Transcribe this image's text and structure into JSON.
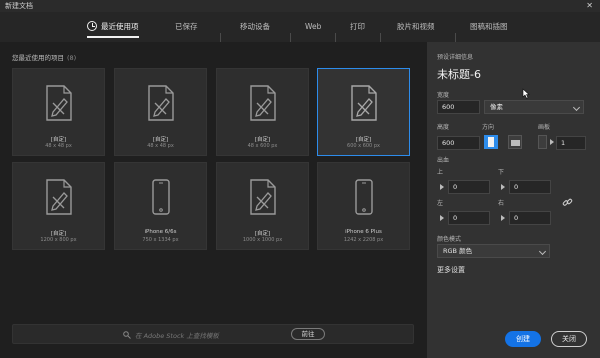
{
  "window": {
    "title": "新建文档",
    "close": "✕"
  },
  "tabs": [
    {
      "label": "最近使用项"
    },
    {
      "label": "已保存"
    },
    {
      "label": "移动设备"
    },
    {
      "label": "Web"
    },
    {
      "label": "打印"
    },
    {
      "label": "胶片和视频"
    },
    {
      "label": "图稿和插图"
    }
  ],
  "recent": {
    "title": "您最近使用的项目",
    "count": "(8)",
    "items": [
      {
        "name": "[自定]",
        "dim": "48 x 48 px",
        "icon": "document-icon"
      },
      {
        "name": "[自定]",
        "dim": "48 x 48 px",
        "icon": "document-icon"
      },
      {
        "name": "[自定]",
        "dim": "48 x 600 px",
        "icon": "document-icon"
      },
      {
        "name": "[自定]",
        "dim": "600 x 600 px",
        "icon": "document-icon"
      },
      {
        "name": "[自定]",
        "dim": "1200 x 800 px",
        "icon": "document-icon"
      },
      {
        "name": "iPhone 6/6s",
        "dim": "750 x 1334 px",
        "icon": "phone-icon"
      },
      {
        "name": "[自定]",
        "dim": "1000 x 1000 px",
        "icon": "document-icon"
      },
      {
        "name": "iPhone 6 Plus",
        "dim": "1242 x 2208 px",
        "icon": "phone-icon"
      }
    ]
  },
  "stock": {
    "placeholder": "在 Adobe Stock 上查找模板",
    "go": "前往"
  },
  "details": {
    "section_title": "预设详细信息",
    "doc_name": "未标题-6",
    "width_label": "宽度",
    "width_value": "600",
    "unit": "像素",
    "height_label": "高度",
    "height_value": "600",
    "orientation_label": "方向",
    "artboard_label": "画板",
    "artboard_value": "1",
    "bleed_label": "出血",
    "top_label": "上",
    "top_value": "0",
    "bottom_label": "下",
    "bottom_value": "0",
    "left_label": "左",
    "left_value": "0",
    "right_label": "右",
    "right_value": "0",
    "color_mode_label": "颜色模式",
    "color_mode_value": "RGB 颜色",
    "more_settings": "更多设置",
    "create": "创建",
    "close": "关闭"
  },
  "colors": {
    "accent": "#1473e6",
    "selected_border": "#2d8ceb"
  }
}
